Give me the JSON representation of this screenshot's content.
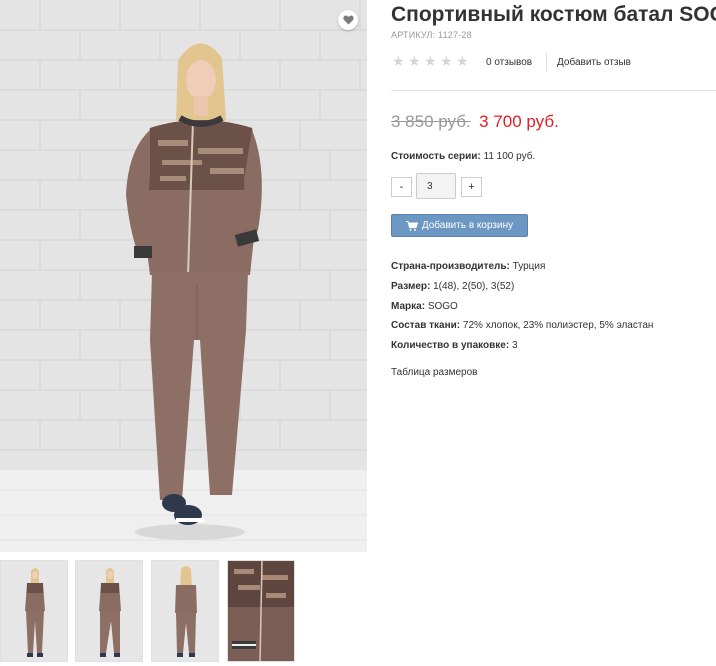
{
  "product": {
    "title": "Спортивный костюм батал SOGO",
    "sku_label": "Артикул:",
    "sku_value": "1127-28",
    "rating": 0,
    "rating_max": 5,
    "reviews_count": "0 отзывов",
    "add_review": "Добавить отзыв",
    "old_price": "3 850 руб.",
    "new_price": "3 700 руб.",
    "series_label": "Стоимость серии:",
    "series_value": "11 100 руб.",
    "quantity": {
      "minus": "-",
      "value": "3",
      "plus": "+"
    },
    "add_to_cart": "Добавить в корзину",
    "attributes": [
      {
        "label": "Страна-производитель:",
        "value": "Турция"
      },
      {
        "label": "Размер:",
        "value": "1(48), 2(50), 3(52)"
      },
      {
        "label": "Марка:",
        "value": "SOGO"
      },
      {
        "label": "Состав ткани:",
        "value": "72% хлопок, 23% полиэстер, 5% эластан"
      },
      {
        "label": "Количество в упаковке:",
        "value": "3"
      }
    ],
    "size_table_link": "Таблица размеров"
  },
  "gallery": {
    "main_image": "model-tracksuit-front",
    "thumbnails": [
      "front-full",
      "front-pose",
      "back-view",
      "jacket-detail"
    ]
  },
  "icons": {
    "favorite": "heart-icon",
    "cart": "cart-icon",
    "star": "star-icon"
  },
  "colors": {
    "old_price": "#999999",
    "new_price": "#e41e26",
    "cart_button": "#6d97c3",
    "star_inactive": "#d4d4d4",
    "suit": "#8b6e63"
  }
}
